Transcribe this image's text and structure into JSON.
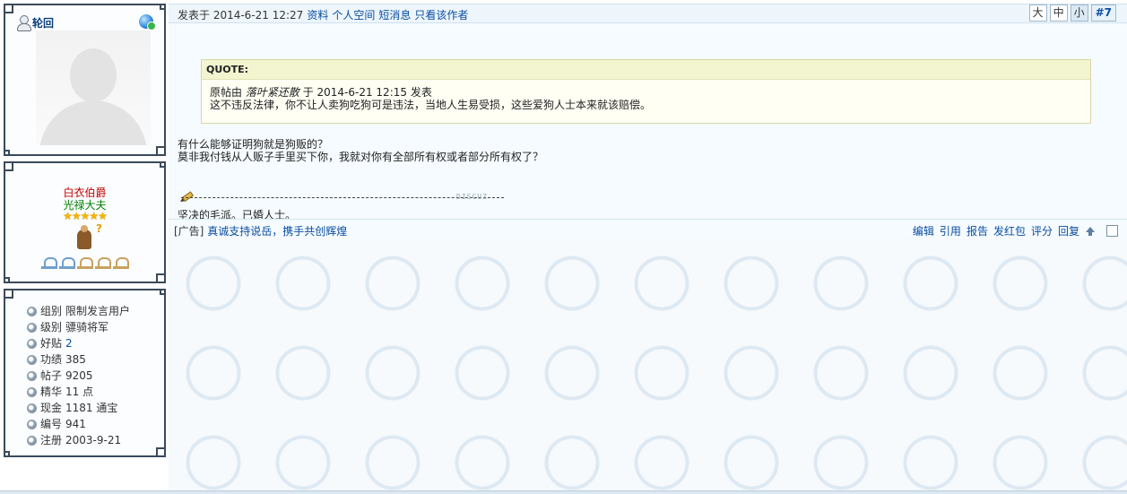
{
  "user": {
    "name": "轮回",
    "rank_title": "白衣伯爵",
    "rank_subtitle": "光禄大夫",
    "stars": "★★★★★",
    "rank_symbol": "?",
    "stats": [
      {
        "label": "组别",
        "value": "限制发言用户",
        "link": false
      },
      {
        "label": "级别",
        "value": "骠骑将军",
        "link": false
      },
      {
        "label": "好贴",
        "value": "2",
        "link": true
      },
      {
        "label": "功绩",
        "value": "385",
        "link": false
      },
      {
        "label": "帖子",
        "value": "9205",
        "link": false
      },
      {
        "label": "精华",
        "value": "11 点",
        "link": false
      },
      {
        "label": "现金",
        "value": "1181 通宝",
        "link": false
      },
      {
        "label": "编号",
        "value": "941",
        "link": false
      },
      {
        "label": "注册",
        "value": "2003-9-21",
        "link": false
      }
    ]
  },
  "post": {
    "posted_prefix": "发表于 2014-6-21 12:27",
    "links": {
      "profile": "资料",
      "space": "个人空间",
      "message": "短消息",
      "only_author": "只看该作者"
    },
    "font_sizes": [
      "大",
      "中",
      "小"
    ],
    "floor": "#7",
    "quote": {
      "header": "QUOTE:",
      "line1_prefix": "原帖由",
      "line1_author": "落叶紧还散",
      "line1_suffix": "于 2014-6-21 12:15 发表",
      "line2": "这不违反法律，你不让人卖狗吃狗可是违法，当地人生易受损，这些爱狗人士本来就该赔偿。"
    },
    "content": [
      "有什么能够证明狗就是狗贩的？",
      "莫非我付钱从人贩子手里买下你，我就对你有全部所有权或者部分所有权了？"
    ],
    "sig_stamp": "DISCUZ",
    "signature": "坚决的毛派。已婚人士。"
  },
  "footer": {
    "ad_label": "[广告]",
    "ad_text": "真诚支持说岳，携手共创辉煌",
    "actions": [
      "编辑",
      "引用",
      "报告",
      "发红包",
      "评分",
      "回复"
    ]
  }
}
